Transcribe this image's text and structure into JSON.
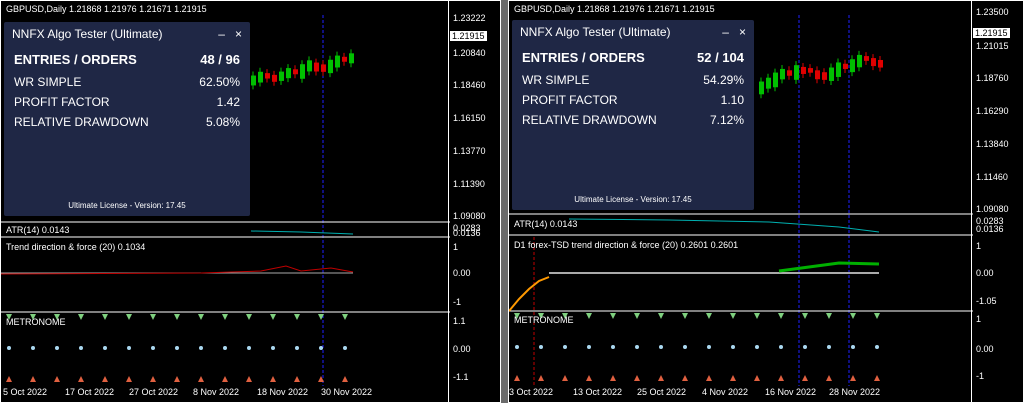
{
  "left": {
    "symbol_title": "GBPUSD,Daily  1.21868 1.21976 1.21671 1.21915",
    "prices": [
      "1.23222",
      "1.20840",
      "1.18460",
      "1.16150",
      "1.13770",
      "1.11390",
      "1.09080"
    ],
    "current_price": "1.21915",
    "atr_label": "ATR(14) 0.0143",
    "atr_axis": [
      "0.0283",
      "0.0136"
    ],
    "indicator2_label": "Trend direction & force (20) 0.1034",
    "ind2_axis": [
      "1",
      "0.00",
      "-1"
    ],
    "metronome_label": "METRONOME",
    "metronome_axis": [
      "1.1",
      "0.00",
      "-1.1"
    ],
    "dates": [
      "5 Oct 2022",
      "17 Oct 2022",
      "27 Oct 2022",
      "8 Nov 2022",
      "18 Nov 2022",
      "30 Nov 2022"
    ],
    "panel": {
      "title": "NNFX Algo Tester (Ultimate)",
      "minimize": "–",
      "close": "×",
      "rows": [
        {
          "label": "ENTRIES / ORDERS",
          "value": "48 / 96"
        },
        {
          "label": "WR SIMPLE",
          "value": "62.50%"
        },
        {
          "label": "PROFIT FACTOR",
          "value": "1.42"
        },
        {
          "label": "RELATIVE DRAWDOWN",
          "value": "5.08%"
        }
      ],
      "license": "Ultimate License - Version: 17.45"
    }
  },
  "right": {
    "symbol_title": "GBPUSD,Daily  1.21868 1.21976 1.21671 1.21915",
    "prices": [
      "1.23500",
      "1.21015",
      "1.18760",
      "1.16290",
      "1.13840",
      "1.11460",
      "1.09080"
    ],
    "current_price": "1.21915",
    "atr_label": "ATR(14) 0.0143",
    "atr_axis": [
      "0.0283",
      "0.0136"
    ],
    "indicator2_label": "D1 forex-TSD trend direction & force (20) 0.2601 0.2601",
    "ind2_axis": [
      "1",
      "0.00",
      "-1.05"
    ],
    "metronome_label": "METRONOME",
    "metronome_axis": [
      "1",
      "0.00",
      "-1"
    ],
    "dates": [
      "3 Oct 2022",
      "13 Oct 2022",
      "25 Oct 2022",
      "4 Nov 2022",
      "16 Nov 2022",
      "28 Nov 2022"
    ],
    "panel": {
      "title": "NNFX Algo Tester (Ultimate)",
      "minimize": "–",
      "close": "×",
      "rows": [
        {
          "label": "ENTRIES / ORDERS",
          "value": "52 / 104"
        },
        {
          "label": "WR SIMPLE",
          "value": "54.29%"
        },
        {
          "label": "PROFIT FACTOR",
          "value": "1.10"
        },
        {
          "label": "RELATIVE DRAWDOWN",
          "value": "7.12%"
        }
      ],
      "license": "Ultimate License - Version: 17.45"
    }
  },
  "colors": {
    "bull": "#00c000",
    "bear": "#e00000",
    "grid": "#0000ff",
    "panel": "#1f2745"
  }
}
